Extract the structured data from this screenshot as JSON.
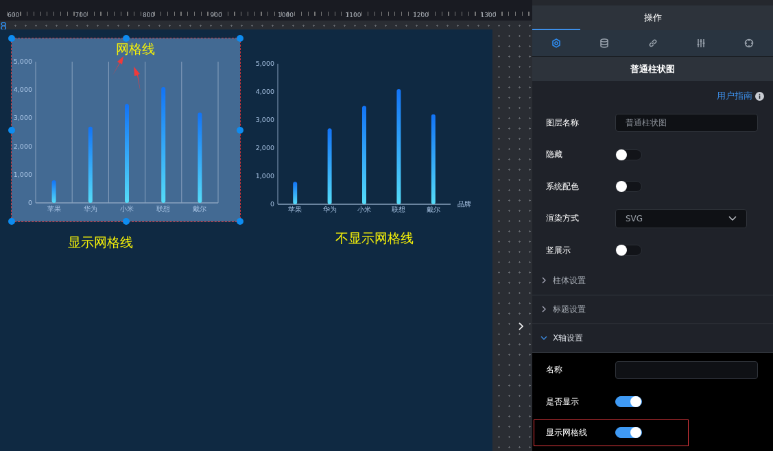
{
  "ruler": {
    "labels": [
      "600",
      "700",
      "800",
      "900",
      "1000",
      "1100",
      "1200",
      "1300"
    ],
    "marker": "8"
  },
  "canvas": {
    "widgets": [
      {
        "selected": true,
        "show_grid": true,
        "annotation": "网格线",
        "caption": "显示网格线",
        "chart_data": {
          "type": "bar",
          "categories": [
            "苹果",
            "华为",
            "小米",
            "联想",
            "戴尔"
          ],
          "values": [
            800,
            2700,
            3500,
            4100,
            3200
          ],
          "ylim": [
            0,
            5000
          ],
          "yticks": [
            {
              "value": 0,
              "label": "0"
            },
            {
              "value": 1000,
              "label": "1,000"
            },
            {
              "value": 2000,
              "label": "2,000"
            },
            {
              "value": 3000,
              "label": "3,000"
            },
            {
              "value": 4000,
              "label": "4,000"
            },
            {
              "value": 5000,
              "label": "5,000"
            }
          ]
        }
      },
      {
        "selected": false,
        "show_grid": false,
        "caption": "不显示网格线",
        "chart_data": {
          "type": "bar",
          "xlabel": "品牌",
          "categories": [
            "苹果",
            "华为",
            "小米",
            "联想",
            "戴尔"
          ],
          "values": [
            800,
            2700,
            3500,
            4100,
            3200
          ],
          "ylim": [
            0,
            5000
          ],
          "yticks": [
            {
              "value": 0,
              "label": "0"
            },
            {
              "value": 1000,
              "label": "1,000"
            },
            {
              "value": 2000,
              "label": "2,000"
            },
            {
              "value": 3000,
              "label": "3,000"
            },
            {
              "value": 4000,
              "label": "4,000"
            },
            {
              "value": 5000,
              "label": "5,000"
            }
          ]
        }
      }
    ]
  },
  "panel": {
    "tab": "操作",
    "icon_tabs": [
      {
        "selected": true
      },
      {
        "selected": false
      },
      {
        "selected": false
      },
      {
        "selected": false
      },
      {
        "selected": false
      }
    ],
    "section_title": "普通柱状图",
    "guide_link": "用户指南",
    "fields": [
      {
        "kind": "input",
        "label": "图层名称",
        "placeholder": "普通柱状图"
      },
      {
        "kind": "toggle",
        "label": "隐藏",
        "on": false
      },
      {
        "kind": "toggle",
        "label": "系统配色",
        "on": false
      },
      {
        "kind": "select",
        "label": "渲染方式",
        "value": "SVG"
      },
      {
        "kind": "toggle",
        "label": "竖展示",
        "on": false
      }
    ],
    "groups": [
      {
        "label": "柱体设置",
        "expanded": false
      },
      {
        "label": "标题设置",
        "expanded": false
      },
      {
        "label": "X轴设置",
        "expanded": true
      }
    ],
    "x_axis_fields": [
      {
        "kind": "input",
        "label": "名称",
        "highlighted": false
      },
      {
        "kind": "toggle",
        "label": "是否显示",
        "on": true,
        "highlighted": false
      },
      {
        "kind": "toggle",
        "label": "显示网格线",
        "on": true,
        "highlighted": true
      }
    ]
  }
}
